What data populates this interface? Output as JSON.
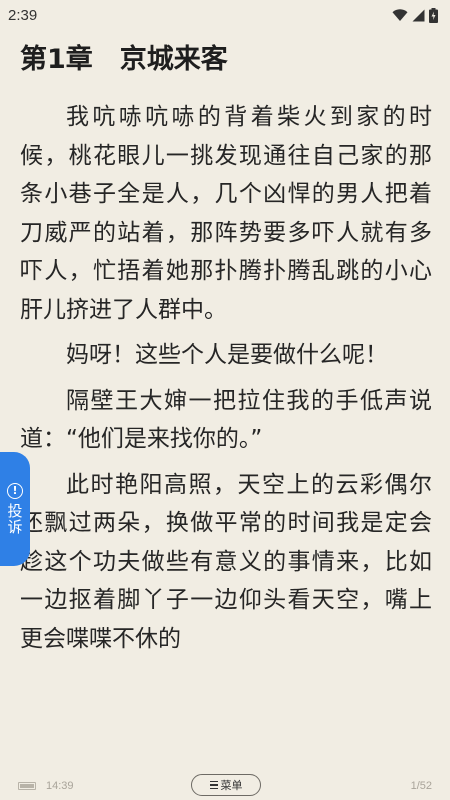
{
  "status_bar": {
    "time": "2:39",
    "icons": [
      "wifi-icon",
      "signal-icon",
      "battery-charging-icon"
    ]
  },
  "chapter": {
    "title": "第1章　京城来客"
  },
  "paragraphs": [
    "我吭哧吭哧的背着柴火到家的时候，桃花眼儿一挑发现通往自己家的那条小巷子全是人，几个凶悍的男人把着刀威严的站着，那阵势要多吓人就有多吓人，忙捂着她那扑腾扑腾乱跳的小心肝儿挤进了人群中。",
    "妈呀！这些个人是要做什么呢！",
    "隔壁王大婶一把拉住我的手低声说道：“他们是来找你的。”",
    "此时艳阳高照，天空上的云彩偶尔还飘过两朵，换做平常的时间我是定会趁这个功夫做些有意义的事情来，比如一边抠着脚丫子一边仰头看天空，嘴上更会喋喋不休的"
  ],
  "complaint_tab": {
    "icon": "alert-circle-icon",
    "label": "投诉"
  },
  "footer": {
    "time": "14:39",
    "menu_label": "菜单",
    "page_indicator": "1/52"
  },
  "colors": {
    "background": "#f1ede3",
    "text": "#262626",
    "accent": "#2f80e6"
  }
}
